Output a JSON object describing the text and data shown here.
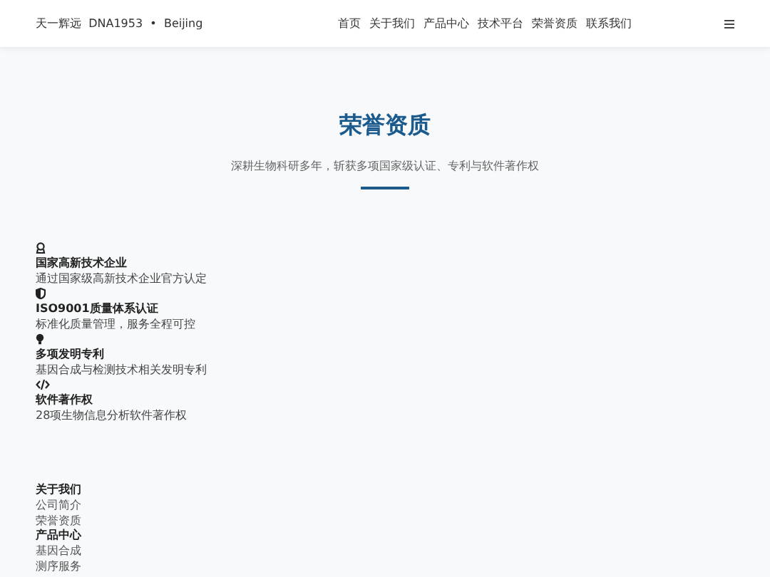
{
  "header": {
    "brand": "天一辉远  DNA1953  •  Beijing",
    "nav": [
      {
        "label": "首页"
      },
      {
        "label": "关于我们"
      },
      {
        "label": "产品中心"
      },
      {
        "label": "技术平台"
      },
      {
        "label": "荣誉资质"
      },
      {
        "label": "联系我们"
      }
    ]
  },
  "hero": {
    "title": "荣誉资质",
    "subtitle": "深耕生物科研多年，斩获多项国家级认证、专利与软件著作权"
  },
  "honors": [
    {
      "kind": "award",
      "title": "国家高新技术企业",
      "desc": "通过国家级高新技术企业官方认定"
    },
    {
      "kind": "shield",
      "title": "ISO9001质量体系认证",
      "desc": "标准化质量管理，服务全程可控"
    },
    {
      "kind": "bulb",
      "title": "多项发明专利",
      "desc": "基因合成与检测技术相关发明专利"
    },
    {
      "kind": "code",
      "title": "软件著作权",
      "desc": "28项生物信息分析软件著作权"
    }
  ],
  "footer": [
    {
      "heading": "关于我们",
      "links": [
        "公司简介",
        "荣誉资质"
      ]
    },
    {
      "heading": "产品中心",
      "links": [
        "基因合成",
        "测序服务"
      ]
    }
  ]
}
